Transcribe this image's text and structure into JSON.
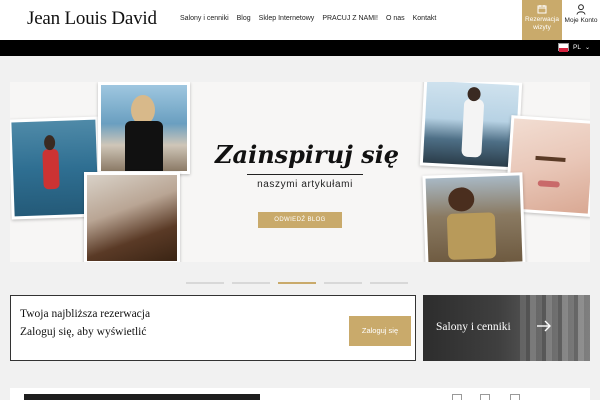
{
  "header": {
    "logo": "Jean Louis David",
    "nav": [
      "Salony i cenniki",
      "Blog",
      "Sklep Internetowy",
      "PRACUJ Z NAMI!",
      "O nas",
      "Kontakt"
    ],
    "reserve_label": "Rezerwacja wizyty",
    "account_label": "Moje Konto",
    "reserve_icon": "calendar-icon",
    "account_icon": "user-icon"
  },
  "language": {
    "code": "PL",
    "flag": "poland-flag-icon"
  },
  "hero": {
    "title": "Zainspiruj się",
    "subtitle": "naszymi artykułami",
    "button": "ODWIEDŹ BLOG"
  },
  "carousel": {
    "slides": 5,
    "active_index": 2
  },
  "reservation": {
    "title": "Twoja najbliższa rezerwacja",
    "text": "Zaloguj się, aby wyświetlić",
    "button": "Zaloguj się"
  },
  "salons": {
    "label": "Salony i cenniki",
    "icon": "arrow-right-icon"
  },
  "colors": {
    "accent": "#c9aa6b",
    "bar": "#000000",
    "background": "#f1f1f1"
  }
}
